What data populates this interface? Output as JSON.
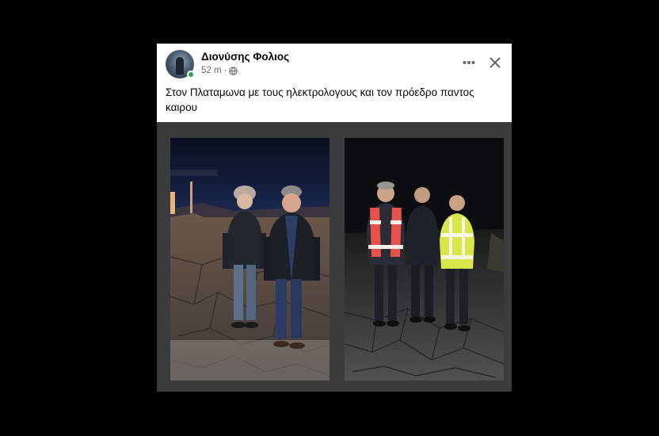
{
  "post": {
    "author": "Διονύσης Φολιος",
    "time": "52 m",
    "separator": "·",
    "privacy_icon": "globe-icon",
    "text": "Στον Πλαταμωνα με τους ηλεκτρολογους και τον πρόεδρο παντος καιρου",
    "more_icon": "more-options-icon",
    "close_icon": "close-icon",
    "online_status_color": "#31a24c"
  },
  "photos": [
    {
      "name": "photo-two-men-at-night-seaside"
    },
    {
      "name": "photo-three-men-with-reflective-vests"
    }
  ],
  "colors": {
    "page_background": "#000000",
    "header_background": "#ffffff",
    "photo_area_background": "#3a3b3c",
    "text_primary": "#050505",
    "text_secondary": "#65676b"
  }
}
